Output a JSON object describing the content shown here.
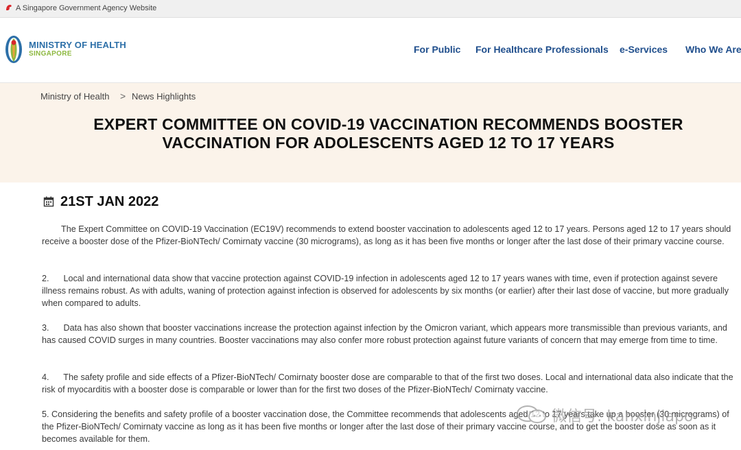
{
  "gov_banner": {
    "text": "A Singapore Government Agency Website"
  },
  "logo": {
    "title": "MINISTRY OF HEALTH",
    "subtitle": "SINGAPORE"
  },
  "nav": {
    "items": [
      {
        "label": "For Public"
      },
      {
        "label": "For Healthcare Professionals"
      },
      {
        "label": "e-Services"
      },
      {
        "label": "Who We Are"
      }
    ]
  },
  "breadcrumb": {
    "items": [
      "Ministry of Health",
      "News Highlights"
    ],
    "separator": ">"
  },
  "article": {
    "title_line1": "EXPERT COMMITTEE ON COVID-19 VACCINATION RECOMMENDS BOOSTER",
    "title_line2": "VACCINATION FOR ADOLESCENTS AGED 12 TO 17 YEARS",
    "date": "21ST JAN 2022",
    "paragraphs": [
      "        The Expert Committee on COVID-19 Vaccination (EC19V) recommends to extend booster vaccination to adolescents aged 12 to 17 years. Persons aged 12 to 17 years should receive a booster dose of the Pfizer-BioNTech/ Comirnaty vaccine (30 micrograms), as long as it has been five months or longer after the last dose of their primary vaccine course.",
      "2.      Local and international data show that vaccine protection against COVID-19 infection in adolescents aged 12 to 17 years wanes with time, even if protection against severe illness remains robust. As with adults, waning of protection against infection is observed for adolescents by six months (or earlier) after their last dose of vaccine, but more gradually when compared to adults.",
      "3.      Data has also shown that booster vaccinations increase the protection against infection by the Omicron variant, which appears more transmissible than previous variants, and has caused COVID surges in many countries. Booster vaccinations may also confer more robust protection against future variants of concern that may emerge from time to time.",
      "4.      The safety profile and side effects of a Pfizer-BioNTech/ Comirnaty booster dose are comparable to that of the first two doses. Local and international data also indicate that the risk of myocarditis with a booster dose is comparable or lower than for the first two doses of the Pfizer-BioNTech/ Comirnaty vaccine.",
      "5. Considering the benefits and safety profile of a booster vaccination dose, the Committee recommends that adolescents aged 12 to 17 years take up a booster (30 micrograms) of the Pfizer-BioNTech/ Comirnaty vaccine as long as it has been five months or longer after the last dose of their primary vaccine course, and to get the booster dose as soon as it becomes available for them."
    ]
  },
  "watermark": {
    "text": "微信号: kanxinjiapo"
  },
  "colors": {
    "nav_text": "#1f4e8c",
    "logo_blue": "#2c6fa8",
    "logo_green": "#8db83f",
    "hero_bg": "#fbf3ea"
  },
  "icons": {
    "banner": "singapore-lion-icon",
    "date": "calendar-icon",
    "breadcrumb_separator": "chevron-right-icon"
  }
}
